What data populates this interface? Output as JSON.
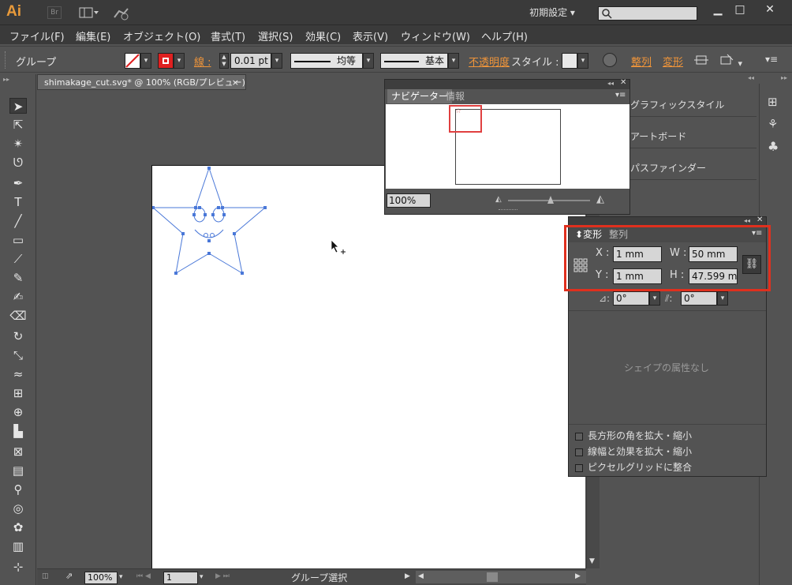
{
  "app": {
    "logo": "Ai",
    "bridge": "Br",
    "workspace": "初期設定"
  },
  "menu": [
    "ファイル(F)",
    "編集(E)",
    "オブジェクト(O)",
    "書式(T)",
    "選択(S)",
    "効果(C)",
    "表示(V)",
    "ウィンドウ(W)",
    "ヘルプ(H)"
  ],
  "controlbar": {
    "selection_type": "グループ",
    "stroke_label": "線",
    "stroke_weight": "0.01 pt",
    "stroke_profile": "均等",
    "brush": "基本",
    "opacity_label": "不透明度",
    "style_label": "スタイル",
    "align_label": "整列",
    "transform_label": "変形"
  },
  "document": {
    "tab_title": "shimakage_cut.svg* @ 100% (RGB/プレビュー)",
    "close": "×"
  },
  "statusbar": {
    "zoom": "100%",
    "artboard": "1",
    "tool_status": "グループ選択"
  },
  "navigator": {
    "tabs": [
      "ナビゲーター",
      "情報"
    ],
    "zoom": "100%"
  },
  "collapsed_panels": [
    "グラフィックスタイル",
    "アートボード",
    "パスファインダー"
  ],
  "transform": {
    "tabs": [
      "変形",
      "整列"
    ],
    "x_label": "X :",
    "x_value": "1 mm",
    "y_label": "Y :",
    "y_value": "1 mm",
    "w_label": "W :",
    "w_value": "50 mm",
    "h_label": "H :",
    "h_value": "47.599 mm",
    "rotate_value": "0°",
    "shear_value": "0°",
    "no_shape_text": "シェイプの属性なし",
    "options": [
      {
        "label": "長方形の角を拡大・縮小",
        "checked": false
      },
      {
        "label": "線幅と効果を拡大・縮小",
        "checked": false
      },
      {
        "label": "ピクセルグリッドに整合",
        "checked": false
      }
    ]
  },
  "colors": {
    "accent": "#f0953a",
    "highlight": "#e0301e",
    "selection": "#4a78d8"
  }
}
